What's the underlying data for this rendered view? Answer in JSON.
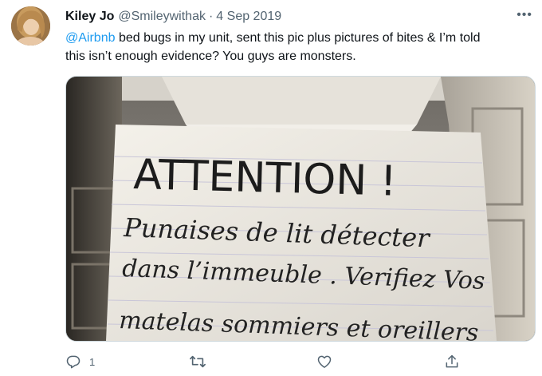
{
  "tweet": {
    "author_name": "Kiley Jo",
    "author_handle": "@Smileywithak",
    "separator": "·",
    "date": "4 Sep 2019",
    "mention": "@Airbnb",
    "text_line1_rest": " bed bugs in my unit, sent this pic plus pictures of bites & I’m told",
    "text_line2": "this isn’t enough evidence? You guys are monsters.",
    "more_label": "•••"
  },
  "image": {
    "sign_line1": "ATTENTION !",
    "sign_line2": "Punaises de lit détecter",
    "sign_line3": "dans l’immeuble . Verifiez Vos",
    "sign_line4": "matelas sommiers et oreillers"
  },
  "actions": {
    "reply_count": "1",
    "icons": [
      "reply-icon",
      "retweet-icon",
      "like-icon",
      "share-icon"
    ]
  },
  "colors": {
    "link": "#1d9bf0",
    "secondary_text": "#536471",
    "primary_text": "#0f1419"
  }
}
